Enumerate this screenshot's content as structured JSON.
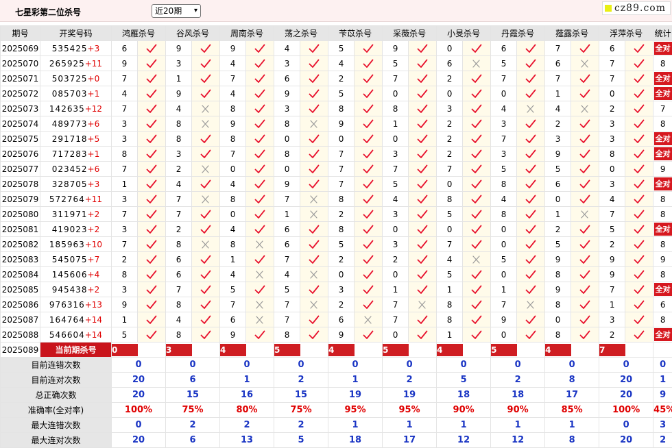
{
  "header": {
    "title": "七星彩第二位杀号",
    "period_select": "近20期",
    "logo": "cz89.com"
  },
  "columns": [
    "期号",
    "开奖号码",
    "鸿雁杀号",
    "谷风杀号",
    "周南杀号",
    "荡之杀号",
    "苄苡杀号",
    "采薇杀号",
    "小旻杀号",
    "丹霞杀号",
    "薤露杀号",
    "浮萍杀号",
    "统计"
  ],
  "all_correct_label": "全对",
  "rows": [
    {
      "period": "2025069",
      "digits": "535425",
      "sum": "+3",
      "experts": [
        [
          6,
          1
        ],
        [
          9,
          1
        ],
        [
          9,
          1
        ],
        [
          4,
          1
        ],
        [
          5,
          1
        ],
        [
          9,
          1
        ],
        [
          0,
          1
        ],
        [
          6,
          1
        ],
        [
          7,
          1
        ],
        [
          6,
          1
        ]
      ],
      "stat": "全对"
    },
    {
      "period": "2025070",
      "digits": "265925",
      "sum": "+11",
      "experts": [
        [
          9,
          1
        ],
        [
          3,
          1
        ],
        [
          4,
          1
        ],
        [
          3,
          1
        ],
        [
          4,
          1
        ],
        [
          5,
          1
        ],
        [
          6,
          0
        ],
        [
          5,
          1
        ],
        [
          6,
          0
        ],
        [
          7,
          1
        ]
      ],
      "stat": "8"
    },
    {
      "period": "2025071",
      "digits": "503725",
      "sum": "+0",
      "experts": [
        [
          7,
          1
        ],
        [
          1,
          1
        ],
        [
          7,
          1
        ],
        [
          6,
          1
        ],
        [
          2,
          1
        ],
        [
          7,
          1
        ],
        [
          2,
          1
        ],
        [
          7,
          1
        ],
        [
          7,
          1
        ],
        [
          7,
          1
        ]
      ],
      "stat": "全对"
    },
    {
      "period": "2025072",
      "digits": "085703",
      "sum": "+1",
      "experts": [
        [
          4,
          1
        ],
        [
          9,
          1
        ],
        [
          4,
          1
        ],
        [
          9,
          1
        ],
        [
          5,
          1
        ],
        [
          0,
          1
        ],
        [
          0,
          1
        ],
        [
          0,
          1
        ],
        [
          1,
          1
        ],
        [
          0,
          1
        ]
      ],
      "stat": "全对"
    },
    {
      "period": "2025073",
      "digits": "142635",
      "sum": "+12",
      "experts": [
        [
          7,
          1
        ],
        [
          4,
          0
        ],
        [
          8,
          1
        ],
        [
          3,
          1
        ],
        [
          8,
          1
        ],
        [
          8,
          1
        ],
        [
          3,
          1
        ],
        [
          4,
          0
        ],
        [
          4,
          0
        ],
        [
          2,
          1
        ]
      ],
      "stat": "7"
    },
    {
      "period": "2025074",
      "digits": "489773",
      "sum": "+6",
      "experts": [
        [
          3,
          1
        ],
        [
          8,
          0
        ],
        [
          9,
          1
        ],
        [
          8,
          0
        ],
        [
          9,
          1
        ],
        [
          1,
          1
        ],
        [
          2,
          1
        ],
        [
          3,
          1
        ],
        [
          2,
          1
        ],
        [
          3,
          1
        ]
      ],
      "stat": "8"
    },
    {
      "period": "2025075",
      "digits": "291718",
      "sum": "+5",
      "experts": [
        [
          3,
          1
        ],
        [
          8,
          1
        ],
        [
          8,
          1
        ],
        [
          0,
          1
        ],
        [
          0,
          1
        ],
        [
          0,
          1
        ],
        [
          2,
          1
        ],
        [
          7,
          1
        ],
        [
          3,
          1
        ],
        [
          3,
          1
        ]
      ],
      "stat": "全对"
    },
    {
      "period": "2025076",
      "digits": "717283",
      "sum": "+1",
      "experts": [
        [
          8,
          1
        ],
        [
          3,
          1
        ],
        [
          7,
          1
        ],
        [
          8,
          1
        ],
        [
          7,
          1
        ],
        [
          3,
          1
        ],
        [
          2,
          1
        ],
        [
          3,
          1
        ],
        [
          9,
          1
        ],
        [
          8,
          1
        ]
      ],
      "stat": "全对"
    },
    {
      "period": "2025077",
      "digits": "023452",
      "sum": "+6",
      "experts": [
        [
          7,
          1
        ],
        [
          2,
          0
        ],
        [
          0,
          1
        ],
        [
          0,
          1
        ],
        [
          7,
          1
        ],
        [
          7,
          1
        ],
        [
          7,
          1
        ],
        [
          5,
          1
        ],
        [
          5,
          1
        ],
        [
          0,
          1
        ]
      ],
      "stat": "9"
    },
    {
      "period": "2025078",
      "digits": "328705",
      "sum": "+3",
      "experts": [
        [
          1,
          1
        ],
        [
          4,
          1
        ],
        [
          4,
          1
        ],
        [
          9,
          1
        ],
        [
          7,
          1
        ],
        [
          5,
          1
        ],
        [
          0,
          1
        ],
        [
          8,
          1
        ],
        [
          6,
          1
        ],
        [
          3,
          1
        ]
      ],
      "stat": "全对"
    },
    {
      "period": "2025079",
      "digits": "572764",
      "sum": "+11",
      "experts": [
        [
          3,
          1
        ],
        [
          7,
          0
        ],
        [
          8,
          1
        ],
        [
          7,
          0
        ],
        [
          8,
          1
        ],
        [
          4,
          1
        ],
        [
          8,
          1
        ],
        [
          4,
          1
        ],
        [
          0,
          1
        ],
        [
          4,
          1
        ]
      ],
      "stat": "8"
    },
    {
      "period": "2025080",
      "digits": "311971",
      "sum": "+2",
      "experts": [
        [
          7,
          1
        ],
        [
          7,
          1
        ],
        [
          0,
          1
        ],
        [
          1,
          0
        ],
        [
          2,
          1
        ],
        [
          3,
          1
        ],
        [
          5,
          1
        ],
        [
          8,
          1
        ],
        [
          1,
          0
        ],
        [
          7,
          1
        ]
      ],
      "stat": "8"
    },
    {
      "period": "2025081",
      "digits": "419023",
      "sum": "+2",
      "experts": [
        [
          3,
          1
        ],
        [
          2,
          1
        ],
        [
          4,
          1
        ],
        [
          6,
          1
        ],
        [
          8,
          1
        ],
        [
          0,
          1
        ],
        [
          0,
          1
        ],
        [
          0,
          1
        ],
        [
          2,
          1
        ],
        [
          5,
          1
        ]
      ],
      "stat": "全对"
    },
    {
      "period": "2025082",
      "digits": "185963",
      "sum": "+10",
      "experts": [
        [
          7,
          1
        ],
        [
          8,
          0
        ],
        [
          8,
          0
        ],
        [
          6,
          1
        ],
        [
          5,
          1
        ],
        [
          3,
          1
        ],
        [
          7,
          1
        ],
        [
          0,
          1
        ],
        [
          5,
          1
        ],
        [
          2,
          1
        ]
      ],
      "stat": "8"
    },
    {
      "period": "2025083",
      "digits": "545075",
      "sum": "+7",
      "experts": [
        [
          2,
          1
        ],
        [
          6,
          1
        ],
        [
          1,
          1
        ],
        [
          7,
          1
        ],
        [
          2,
          1
        ],
        [
          2,
          1
        ],
        [
          4,
          0
        ],
        [
          5,
          1
        ],
        [
          9,
          1
        ],
        [
          9,
          1
        ]
      ],
      "stat": "9"
    },
    {
      "period": "2025084",
      "digits": "145606",
      "sum": "+4",
      "experts": [
        [
          8,
          1
        ],
        [
          6,
          1
        ],
        [
          4,
          0
        ],
        [
          4,
          0
        ],
        [
          0,
          1
        ],
        [
          0,
          1
        ],
        [
          5,
          1
        ],
        [
          0,
          1
        ],
        [
          8,
          1
        ],
        [
          9,
          1
        ]
      ],
      "stat": "8"
    },
    {
      "period": "2025085",
      "digits": "945438",
      "sum": "+2",
      "experts": [
        [
          3,
          1
        ],
        [
          7,
          1
        ],
        [
          5,
          1
        ],
        [
          5,
          1
        ],
        [
          3,
          1
        ],
        [
          1,
          1
        ],
        [
          1,
          1
        ],
        [
          1,
          1
        ],
        [
          9,
          1
        ],
        [
          7,
          1
        ]
      ],
      "stat": "全对"
    },
    {
      "period": "2025086",
      "digits": "976316",
      "sum": "+13",
      "experts": [
        [
          9,
          1
        ],
        [
          8,
          1
        ],
        [
          7,
          0
        ],
        [
          7,
          0
        ],
        [
          2,
          1
        ],
        [
          7,
          0
        ],
        [
          8,
          1
        ],
        [
          7,
          0
        ],
        [
          8,
          1
        ],
        [
          1,
          1
        ]
      ],
      "stat": "6"
    },
    {
      "period": "2025087",
      "digits": "164764",
      "sum": "+14",
      "experts": [
        [
          1,
          1
        ],
        [
          4,
          1
        ],
        [
          6,
          0
        ],
        [
          7,
          1
        ],
        [
          6,
          0
        ],
        [
          7,
          1
        ],
        [
          8,
          1
        ],
        [
          9,
          1
        ],
        [
          0,
          1
        ],
        [
          3,
          1
        ]
      ],
      "stat": "8"
    },
    {
      "period": "2025088",
      "digits": "546604",
      "sum": "+14",
      "experts": [
        [
          5,
          1
        ],
        [
          8,
          1
        ],
        [
          9,
          1
        ],
        [
          8,
          1
        ],
        [
          9,
          1
        ],
        [
          0,
          1
        ],
        [
          1,
          1
        ],
        [
          0,
          1
        ],
        [
          8,
          1
        ],
        [
          2,
          1
        ]
      ],
      "stat": "全对"
    }
  ],
  "current": {
    "period": "2025089",
    "label": "当前期杀号",
    "values": [
      "0",
      "3",
      "4",
      "5",
      "4",
      "5",
      "4",
      "5",
      "4",
      "7"
    ]
  },
  "summary": [
    {
      "label": "目前连错次数",
      "values": [
        "0",
        "0",
        "0",
        "0",
        "0",
        "0",
        "0",
        "0",
        "0",
        "0",
        "0"
      ]
    },
    {
      "label": "目前连对次数",
      "values": [
        "20",
        "6",
        "1",
        "2",
        "1",
        "2",
        "5",
        "2",
        "8",
        "20",
        "1"
      ]
    },
    {
      "label": "总正确次数",
      "values": [
        "20",
        "15",
        "16",
        "15",
        "19",
        "19",
        "18",
        "18",
        "17",
        "20",
        "9"
      ]
    },
    {
      "label": "准确率(全对率)",
      "values": [
        "100%",
        "75%",
        "80%",
        "75%",
        "95%",
        "95%",
        "90%",
        "90%",
        "85%",
        "100%",
        "45%"
      ]
    },
    {
      "label": "最大连错次数",
      "values": [
        "0",
        "2",
        "2",
        "2",
        "1",
        "1",
        "1",
        "1",
        "1",
        "0",
        "3"
      ]
    },
    {
      "label": "最大连对次数",
      "values": [
        "20",
        "6",
        "13",
        "5",
        "18",
        "17",
        "12",
        "12",
        "8",
        "20",
        "2"
      ]
    }
  ],
  "colors": {
    "check": "#e8112d",
    "cross": "#9a9a9a",
    "badge": "#d6181f",
    "blue_value": "#1a35c4",
    "red_value": "#e00000",
    "header_bg": "#e6e6e6",
    "mark_bg": "#fffbea"
  }
}
